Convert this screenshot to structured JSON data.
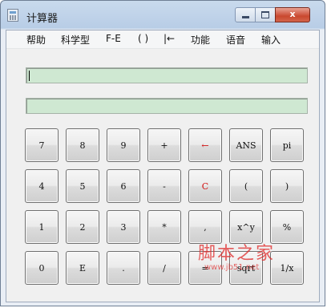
{
  "window": {
    "title": "计算器",
    "controls": {
      "minimize_icon": "minimize-icon",
      "maximize_icon": "maximize-icon",
      "close_label": "x"
    }
  },
  "menu": [
    {
      "label": "帮助"
    },
    {
      "label": "科学型"
    },
    {
      "label": "F-E"
    },
    {
      "label": "( )"
    },
    {
      "label": "|←"
    },
    {
      "label": "功能"
    },
    {
      "label": "语音"
    },
    {
      "label": "输入"
    }
  ],
  "expression_input": {
    "value": ""
  },
  "result_display": {
    "value": ""
  },
  "keypad": [
    [
      "7",
      "8",
      "9",
      "+",
      "←",
      "ANS",
      "pi"
    ],
    [
      "4",
      "5",
      "6",
      "-",
      "C",
      "(",
      ")"
    ],
    [
      "1",
      "2",
      "3",
      "*",
      ",",
      "x^y",
      "%"
    ],
    [
      "0",
      "E",
      ".",
      "/",
      "=",
      "sqrt",
      "1/x"
    ]
  ],
  "accent_colors": {
    "key_text": "#111111",
    "clear_key_text": "#d21414",
    "display_background": "#cfe8d2"
  },
  "watermark": {
    "main": "脚本之家",
    "sub": "www.jb51.net"
  }
}
